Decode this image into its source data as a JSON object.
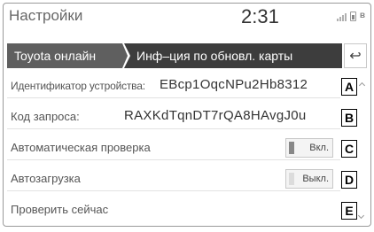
{
  "header": {
    "title": "Настройки",
    "clock": "2:31",
    "status_icons": [
      "signal-icon",
      "battery-icon",
      "bluetooth-icon"
    ],
    "bluetooth_glyph": "ʙ"
  },
  "tabs": {
    "tab1_label": "Toyota онлайн",
    "tab2_label": "Инф–ция по обновл. карты",
    "back_glyph": "↩"
  },
  "rows": {
    "device_id_label": "Идентификатор устройства:",
    "device_id_value": "EBcp1OqcNPu2Hb8312",
    "request_code_label": "Код запроса:",
    "request_code_value": "RAXKdTqnDT7rQA8HAvgJ0u",
    "auto_check_label": "Автоматическая проверка",
    "auto_check_toggle": "Вкл.",
    "auto_download_label": "Автозагрузка",
    "auto_download_toggle": "Выкл.",
    "check_now_label": "Проверить сейчас"
  },
  "callouts": {
    "a": "A",
    "b": "B",
    "c": "C",
    "d": "D",
    "e": "E"
  },
  "colors": {
    "tab_active": "#3d3d3d",
    "tab_inactive": "#5f5f5f",
    "toggle_on_indicator": "#888888",
    "toggle_off_indicator": "#dcdcdc"
  }
}
